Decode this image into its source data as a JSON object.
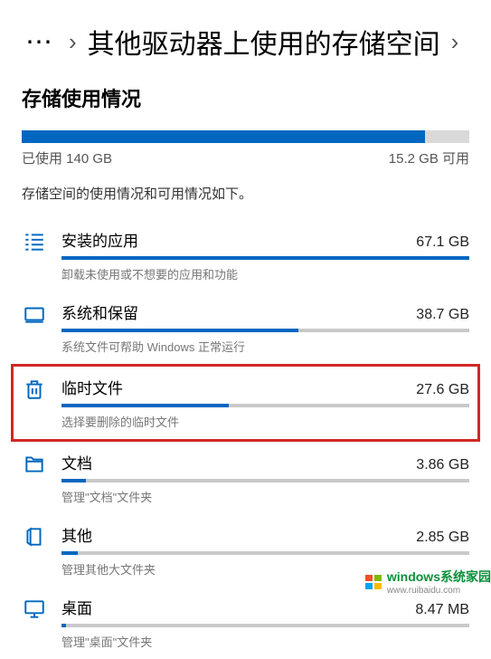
{
  "breadcrumb": {
    "ellipsis": "⋯",
    "title": "其他驱动器上使用的存储空间"
  },
  "heading": "存储使用情况",
  "overall": {
    "used_pct": 90,
    "used_label": "已使用 140 GB",
    "free_label": "15.2 GB 可用"
  },
  "description": "存储空间的使用情况和可用情况如下。",
  "categories": [
    {
      "id": "apps",
      "title": "安装的应用",
      "size": "67.1 GB",
      "pct": 100,
      "sub": "卸载未使用或不想要的应用和功能",
      "highlight": false
    },
    {
      "id": "system",
      "title": "系统和保留",
      "size": "38.7 GB",
      "pct": 58,
      "sub": "系统文件可帮助 Windows 正常运行",
      "highlight": false
    },
    {
      "id": "temp",
      "title": "临时文件",
      "size": "27.6 GB",
      "pct": 41,
      "sub": "选择要删除的临时文件",
      "highlight": true
    },
    {
      "id": "documents",
      "title": "文档",
      "size": "3.86 GB",
      "pct": 6,
      "sub": "管理\"文档\"文件夹",
      "highlight": false
    },
    {
      "id": "other",
      "title": "其他",
      "size": "2.85 GB",
      "pct": 4,
      "sub": "管理其他大文件夹",
      "highlight": false
    },
    {
      "id": "desktop",
      "title": "桌面",
      "size": "8.47 MB",
      "pct": 1,
      "sub": "管理\"桌面\"文件夹",
      "highlight": false
    }
  ],
  "watermark": {
    "line1": "windows系统家园",
    "line2": "www.ruibaidu.com"
  }
}
